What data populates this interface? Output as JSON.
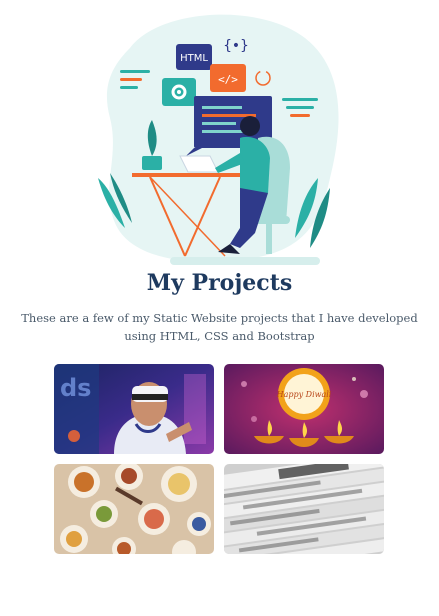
{
  "hero": {
    "code_badge": "HTML",
    "brace_badge": "{•}",
    "tag_badge": "</>"
  },
  "header": {
    "title": "My Projects",
    "subtitle": "These are a few of my Static Website projects that I have developed using HTML, CSS and Bootstrap"
  },
  "projects": [
    {
      "name": "vr-project-thumbnail",
      "icon": "vr-headset"
    },
    {
      "name": "diwali-project-thumbnail",
      "icon": "diya-lamp",
      "caption": "Happy Diwali"
    },
    {
      "name": "food-project-thumbnail",
      "icon": "food-table"
    },
    {
      "name": "news-project-thumbnail",
      "icon": "newspapers"
    }
  ],
  "colors": {
    "title": "#1e3a5f",
    "accent_teal": "#2bb0a6",
    "accent_orange": "#f26b2e",
    "navy": "#2f3a8a"
  }
}
